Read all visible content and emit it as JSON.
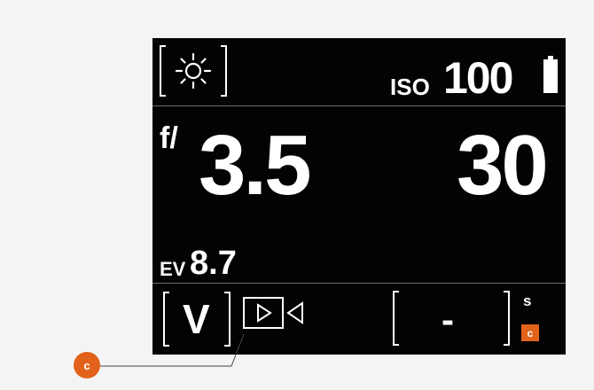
{
  "top_bar": {
    "white_balance_icon": "sun-icon",
    "iso_label": "ISO",
    "iso_value": "100",
    "battery_icon": "battery-icon"
  },
  "exposure": {
    "aperture_prefix": "f/",
    "aperture_value": "3.5",
    "shutter_value": "30",
    "ev_label": "EV",
    "ev_value": "8.7"
  },
  "bottom_bar": {
    "mode_label": "V",
    "video_icon": "video-mode-icon",
    "timer_value": "-",
    "timer_unit": "s",
    "timer_badge": "c"
  },
  "callout": {
    "label": "c"
  },
  "colors": {
    "screen": "#030303",
    "accent": "#e2621b",
    "background": "#f4f4f4"
  }
}
